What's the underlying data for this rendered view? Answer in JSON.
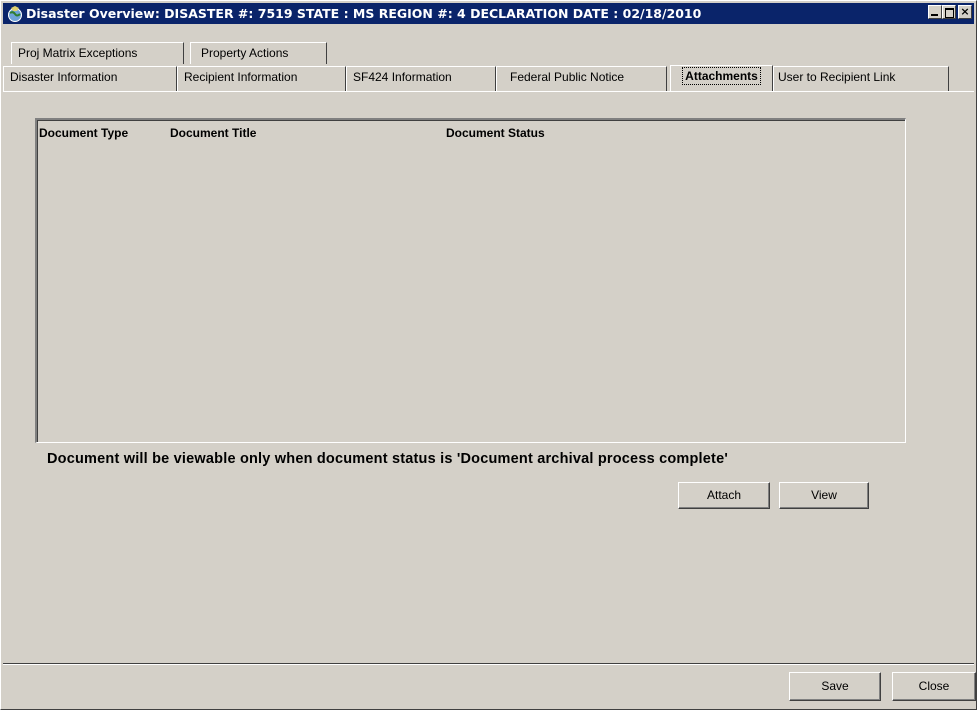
{
  "window": {
    "title": "Disaster Overview:  DISASTER #: 7519   STATE : MS   REGION #: 4   DECLARATION DATE : 02/18/2010",
    "icon": "globe-app-icon",
    "title_bar_color": "#0a246a"
  },
  "tabs": {
    "row1": [
      {
        "label": "Proj Matrix Exceptions"
      },
      {
        "label": "Property Actions"
      }
    ],
    "row2": [
      {
        "label": "Disaster Information"
      },
      {
        "label": "Recipient  Information"
      },
      {
        "label": "SF424  Information"
      },
      {
        "label": "Federal Public Notice"
      },
      {
        "label": "Attachments",
        "active": true
      },
      {
        "label": "User to Recipient Link"
      }
    ]
  },
  "grid": {
    "columns": [
      "Document Type",
      "Document Title",
      "Document Status"
    ],
    "rows": []
  },
  "info_text": "Document will be viewable only when document status is 'Document archival process complete'",
  "buttons": {
    "attach": "Attach",
    "view": "View",
    "save": "Save",
    "close": "Close"
  }
}
